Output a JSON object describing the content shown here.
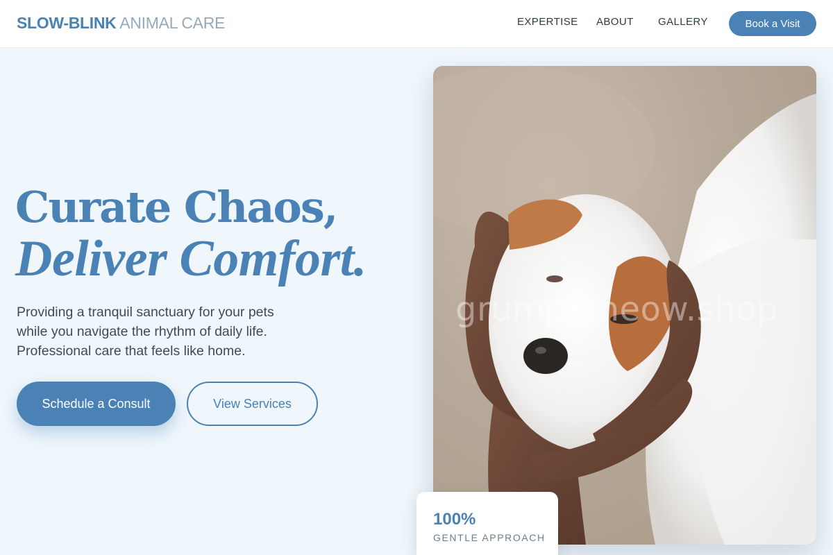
{
  "header": {
    "logo_strong": "SLOW-BLINK",
    "logo_light": "ANIMAL CARE",
    "nav": [
      "EXPERTISE",
      "ABOUT",
      "GALLERY"
    ],
    "cta_label": "Book a Visit"
  },
  "hero": {
    "headline_line1": "Curate Chaos,",
    "headline_line2": "Deliver Comfort.",
    "subtitle_lines": [
      "Providing a tranquil sanctuary for your pets",
      "while you navigate the rhythm of daily life.",
      "Professional care that feels like home."
    ],
    "primary_button": "Schedule a Consult",
    "secondary_button": "View Services"
  },
  "image": {
    "subject": "puppy-cradled-in-hands",
    "watermark": "grumpymeow.shop"
  },
  "stat": {
    "value": "100%",
    "label": "GENTLE APPROACH"
  },
  "colors": {
    "accent": "#4a82b5",
    "background": "#eff6fc",
    "header_bg": "#ffffff",
    "text": "#3f4b58"
  }
}
